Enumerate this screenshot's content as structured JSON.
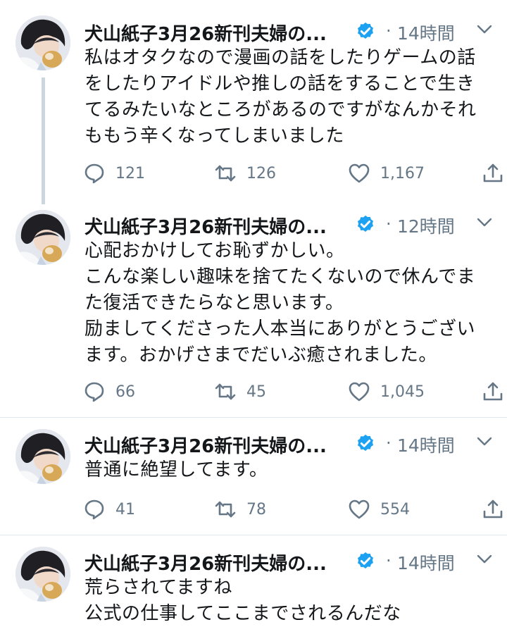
{
  "timeline": {
    "tweets": [
      {
        "name": "犬山紙子3月26新刊夫婦の...",
        "time": "14時間",
        "text_lines": [
          "私はオタクなので漫画の話をしたりゲームの話",
          "をしたりアイドルや推しの話をすることで生き",
          "てるみたいなところがあるのですがなんかそれ",
          "ももう辛くなってしまいました"
        ],
        "replies": "121",
        "retweets": "126",
        "likes": "1,167"
      },
      {
        "name": "犬山紙子3月26新刊夫婦の...",
        "time": "12時間",
        "text_lines": [
          "心配おかけしてお恥ずかしい。",
          "こんな楽しい趣味を捨てたくないので休んでま",
          "た復活できたらなと思います。",
          "励ましてくださった人本当にありがとうござい",
          "ます。おかげさまでだいぶ癒されました。"
        ],
        "replies": "66",
        "retweets": "45",
        "likes": "1,045"
      },
      {
        "name": "犬山紙子3月26新刊夫婦の...",
        "time": "14時間",
        "text_lines": [
          "普通に絶望してます。"
        ],
        "replies": "41",
        "retweets": "78",
        "likes": "554"
      },
      {
        "name": "犬山紙子3月26新刊夫婦の...",
        "time": "14時間",
        "text_lines": [
          "荒らされてますね",
          "公式の仕事してここまでされるんだな"
        ]
      }
    ],
    "separator_dot": "·",
    "icons": {
      "verified": "verified-badge-icon",
      "caret": "chevron-down-icon",
      "reply": "reply-icon",
      "retweet": "retweet-icon",
      "like": "heart-icon",
      "share": "share-icon"
    },
    "colors": {
      "verified": "#1da1f2",
      "meta": "#657786",
      "text": "#14171a",
      "thread_line": "#ccd6dd"
    }
  }
}
